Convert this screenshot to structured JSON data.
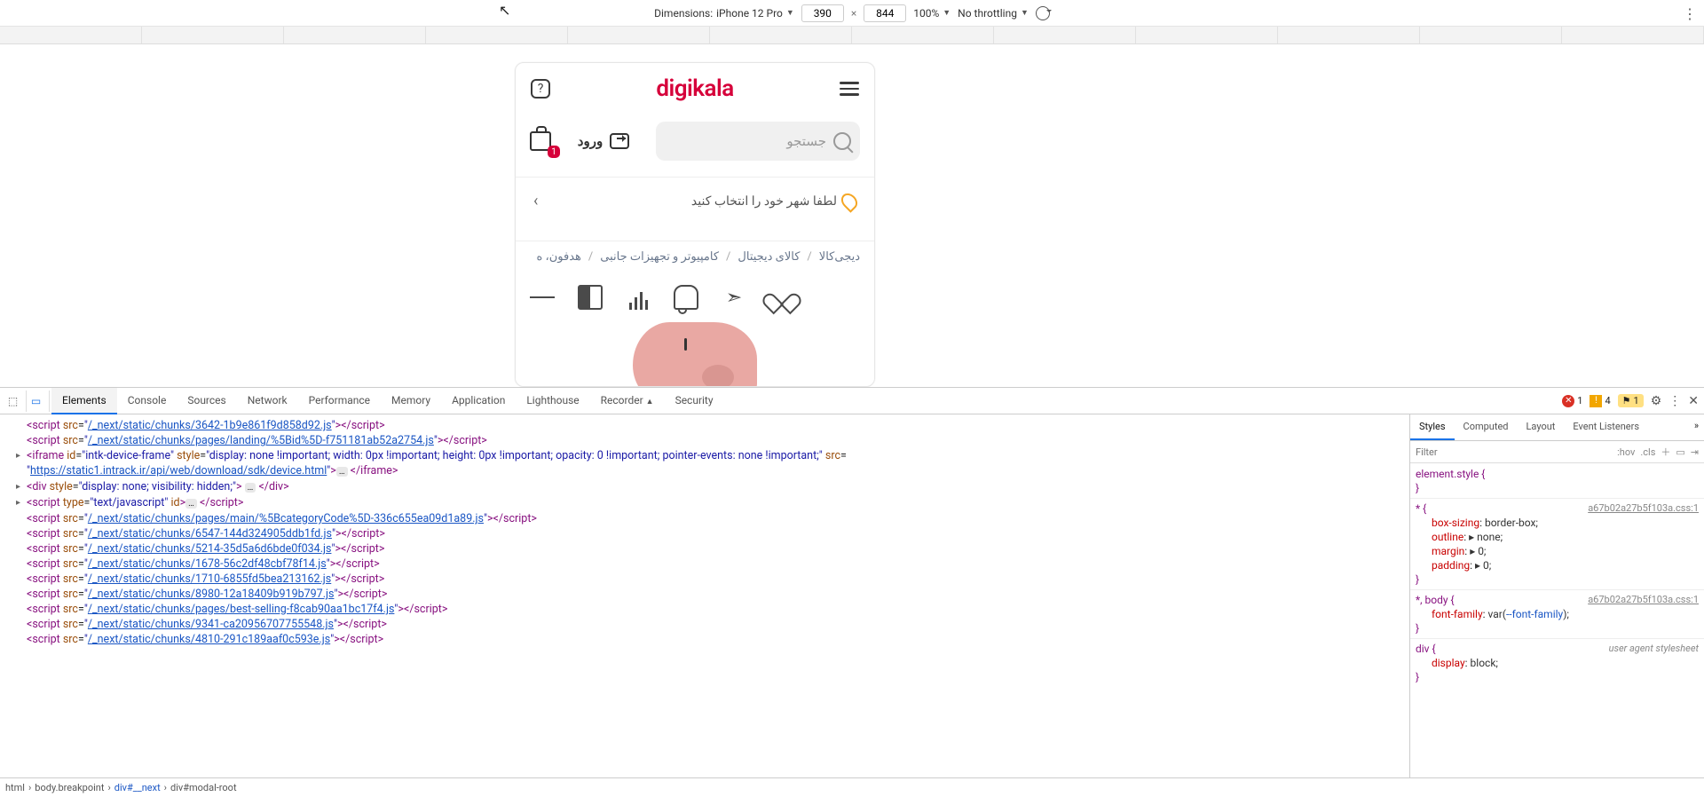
{
  "deviceBar": {
    "dimensionsLabel": "Dimensions:",
    "device": "iPhone 12 Pro",
    "width": "390",
    "height": "844",
    "zoom": "100%",
    "throttling": "No throttling",
    "rulerGuides": 12
  },
  "app": {
    "logo": "digikala",
    "loginLabel": "ورود",
    "searchPlaceholder": "جستجو",
    "cartBadge": "1",
    "citySelect": "لطفا شهر خود را انتخاب کنید",
    "breadcrumb": {
      "items": [
        "دیجی‌کالا",
        "کالای دیجیتال",
        "کامپیوتر و تجهیزات جانبی",
        "هدفون، ه"
      ]
    }
  },
  "devtools": {
    "tabs": [
      "Elements",
      "Console",
      "Sources",
      "Network",
      "Performance",
      "Memory",
      "Application",
      "Lighthouse",
      "Recorder �experimental",
      "Security"
    ],
    "activeTab": "Elements",
    "errors": "1",
    "warnings": "4",
    "messages": "1",
    "recorderBadge": "⚑",
    "stylesTabs": [
      "Styles",
      "Computed",
      "Layout",
      "Event Listeners"
    ],
    "activeStyleTab": "Styles",
    "filterPlaceholder": "Filter",
    "hovLabel": ":hov",
    "clsLabel": ".cls",
    "dom": [
      {
        "indent": 1,
        "html": "<span class=tag>&lt;script</span> <span class=attr>src</span>=<span class=val>\"</span><span class=link>/_next/static/chunks/3642-1b9e861f9d858d92.js</span><span class=val>\"</span><span class=tag>&gt;&lt;/script&gt;</span>"
      },
      {
        "indent": 1,
        "html": "<span class=tag>&lt;script</span> <span class=attr>src</span>=<span class=val>\"</span><span class=link>/_next/static/chunks/pages/landing/%5Bid%5D-f751181ab52a2754.js</span><span class=val>\"</span><span class=tag>&gt;&lt;/script&gt;</span>"
      },
      {
        "indent": 1,
        "caret": true,
        "html": "<span class=tag>&lt;iframe</span> <span class=attr>id</span>=<span class=val>\"intk-device-frame\"</span> <span class=attr>style</span>=<span class=val>\"display: none !important; width: 0px !important; height: 0px !important; opacity: 0 !important; pointer-events: none !important;\"</span> <span class=attr>src</span>="
      },
      {
        "indent": 1,
        "html": "<span class=val>\"</span><span class=link>https://static1.intrack.ir/api/web/download/sdk/device.html</span><span class=val>\"</span><span class=tag>&gt;</span><span class=ell>…</span> <span class=tag>&lt;/iframe&gt;</span>"
      },
      {
        "indent": 1,
        "caret": true,
        "html": "<span class=tag>&lt;div</span> <span class=attr>style</span>=<span class=val>\"display: none; visibility: hidden;\"</span><span class=tag>&gt;</span> <span class=ell>…</span> <span class=tag>&lt;/div&gt;</span>"
      },
      {
        "indent": 1,
        "caret": true,
        "html": "<span class=tag>&lt;script</span> <span class=attr>type</span>=<span class=val>\"text/javascript\"</span> <span class=attr>id</span><span class=tag>&gt;</span><span class=ell>…</span> <span class=tag>&lt;/script&gt;</span>"
      },
      {
        "indent": 1,
        "html": "<span class=tag>&lt;script</span> <span class=attr>src</span>=<span class=val>\"</span><span class=link>/_next/static/chunks/pages/main/%5BcategoryCode%5D-336c655ea09d1a89.js</span><span class=val>\"</span><span class=tag>&gt;&lt;/script&gt;</span>"
      },
      {
        "indent": 1,
        "html": "<span class=tag>&lt;script</span> <span class=attr>src</span>=<span class=val>\"</span><span class=link>/_next/static/chunks/6547-144d324905ddb1fd.js</span><span class=val>\"</span><span class=tag>&gt;&lt;/script&gt;</span>"
      },
      {
        "indent": 1,
        "html": "<span class=tag>&lt;script</span> <span class=attr>src</span>=<span class=val>\"</span><span class=link>/_next/static/chunks/5214-35d5a6d6bde0f034.js</span><span class=val>\"</span><span class=tag>&gt;&lt;/script&gt;</span>"
      },
      {
        "indent": 1,
        "html": "<span class=tag>&lt;script</span> <span class=attr>src</span>=<span class=val>\"</span><span class=link>/_next/static/chunks/1678-56c2df48cbf78f14.js</span><span class=val>\"</span><span class=tag>&gt;&lt;/script&gt;</span>"
      },
      {
        "indent": 1,
        "html": "<span class=tag>&lt;script</span> <span class=attr>src</span>=<span class=val>\"</span><span class=link>/_next/static/chunks/1710-6855fd5bea213162.js</span><span class=val>\"</span><span class=tag>&gt;&lt;/script&gt;</span>"
      },
      {
        "indent": 1,
        "html": "<span class=tag>&lt;script</span> <span class=attr>src</span>=<span class=val>\"</span><span class=link>/_next/static/chunks/8980-12a18409b919b797.js</span><span class=val>\"</span><span class=tag>&gt;&lt;/script&gt;</span>"
      },
      {
        "indent": 1,
        "html": "<span class=tag>&lt;script</span> <span class=attr>src</span>=<span class=val>\"</span><span class=link>/_next/static/chunks/pages/best-selling-f8cab90aa1bc17f4.js</span><span class=val>\"</span><span class=tag>&gt;&lt;/script&gt;</span>"
      },
      {
        "indent": 1,
        "html": "<span class=tag>&lt;script</span> <span class=attr>src</span>=<span class=val>\"</span><span class=link>/_next/static/chunks/9341-ca20956707755548.js</span><span class=val>\"</span><span class=tag>&gt;&lt;/script&gt;</span>"
      },
      {
        "indent": 1,
        "html": "<span class=tag>&lt;script</span> <span class=attr>src</span>=<span class=val>\"</span><span class=link>/_next/static/chunks/4810-291c189aaf0c593e.js</span><span class=val>\"</span><span class=tag>&gt;&lt;/script&gt;</span>"
      }
    ],
    "styles": {
      "rules": [
        {
          "selector": "element.style {",
          "src": "",
          "props": []
        },
        {
          "selector": "* {",
          "src": "a67b02a27b5f103a.css:1",
          "props": [
            {
              "k": "box-sizing",
              "v": "border-box;"
            },
            {
              "k": "outline",
              "v": "▸ none;"
            },
            {
              "k": "margin",
              "v": "▸ 0;"
            },
            {
              "k": "padding",
              "v": "▸ 0;"
            }
          ]
        },
        {
          "selector": "*, body {",
          "src": "a67b02a27b5f103a.css:1",
          "props": [
            {
              "k": "font-family",
              "v": "var(<span class=kw>--font-family</span>);"
            }
          ]
        },
        {
          "selector": "div {",
          "ua": "user agent stylesheet",
          "props": [
            {
              "k": "display",
              "v": "block;"
            }
          ]
        }
      ]
    },
    "crumbs": [
      "html",
      "body.breakpoint",
      "div#__next",
      "div#modal-root"
    ]
  }
}
